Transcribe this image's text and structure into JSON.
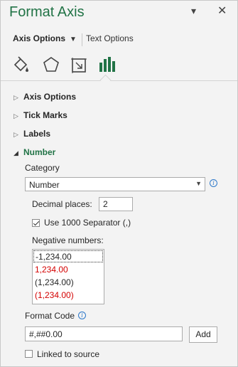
{
  "header": {
    "title": "Format Axis"
  },
  "tabs": {
    "axis_options": "Axis Options",
    "text_options": "Text Options"
  },
  "sections": [
    {
      "label": "Axis Options",
      "expanded": false
    },
    {
      "label": "Tick Marks",
      "expanded": false
    },
    {
      "label": "Labels",
      "expanded": false
    },
    {
      "label": "Number",
      "expanded": true
    }
  ],
  "number": {
    "category_label": "Category",
    "category_value": "Number",
    "decimal_label": "Decimal places:",
    "decimal_value": "2",
    "separator_label": "Use 1000 Separator (,)",
    "separator_checked": true,
    "negative_label": "Negative numbers:",
    "negative_options": [
      {
        "text": "-1,234.00",
        "color": "#000000",
        "selected": true
      },
      {
        "text": "1,234.00",
        "color": "#d40000",
        "selected": false
      },
      {
        "text": "(1,234.00)",
        "color": "#000000",
        "selected": false
      },
      {
        "text": "(1,234.00)",
        "color": "#d40000",
        "selected": false
      }
    ],
    "format_code_label": "Format Code",
    "format_code_value": "#,##0.00",
    "add_label": "Add",
    "linked_label": "Linked to source",
    "linked_checked": false
  },
  "colors": {
    "accent": "#217346",
    "negative_red": "#d40000",
    "info_blue": "#2b77c9"
  }
}
